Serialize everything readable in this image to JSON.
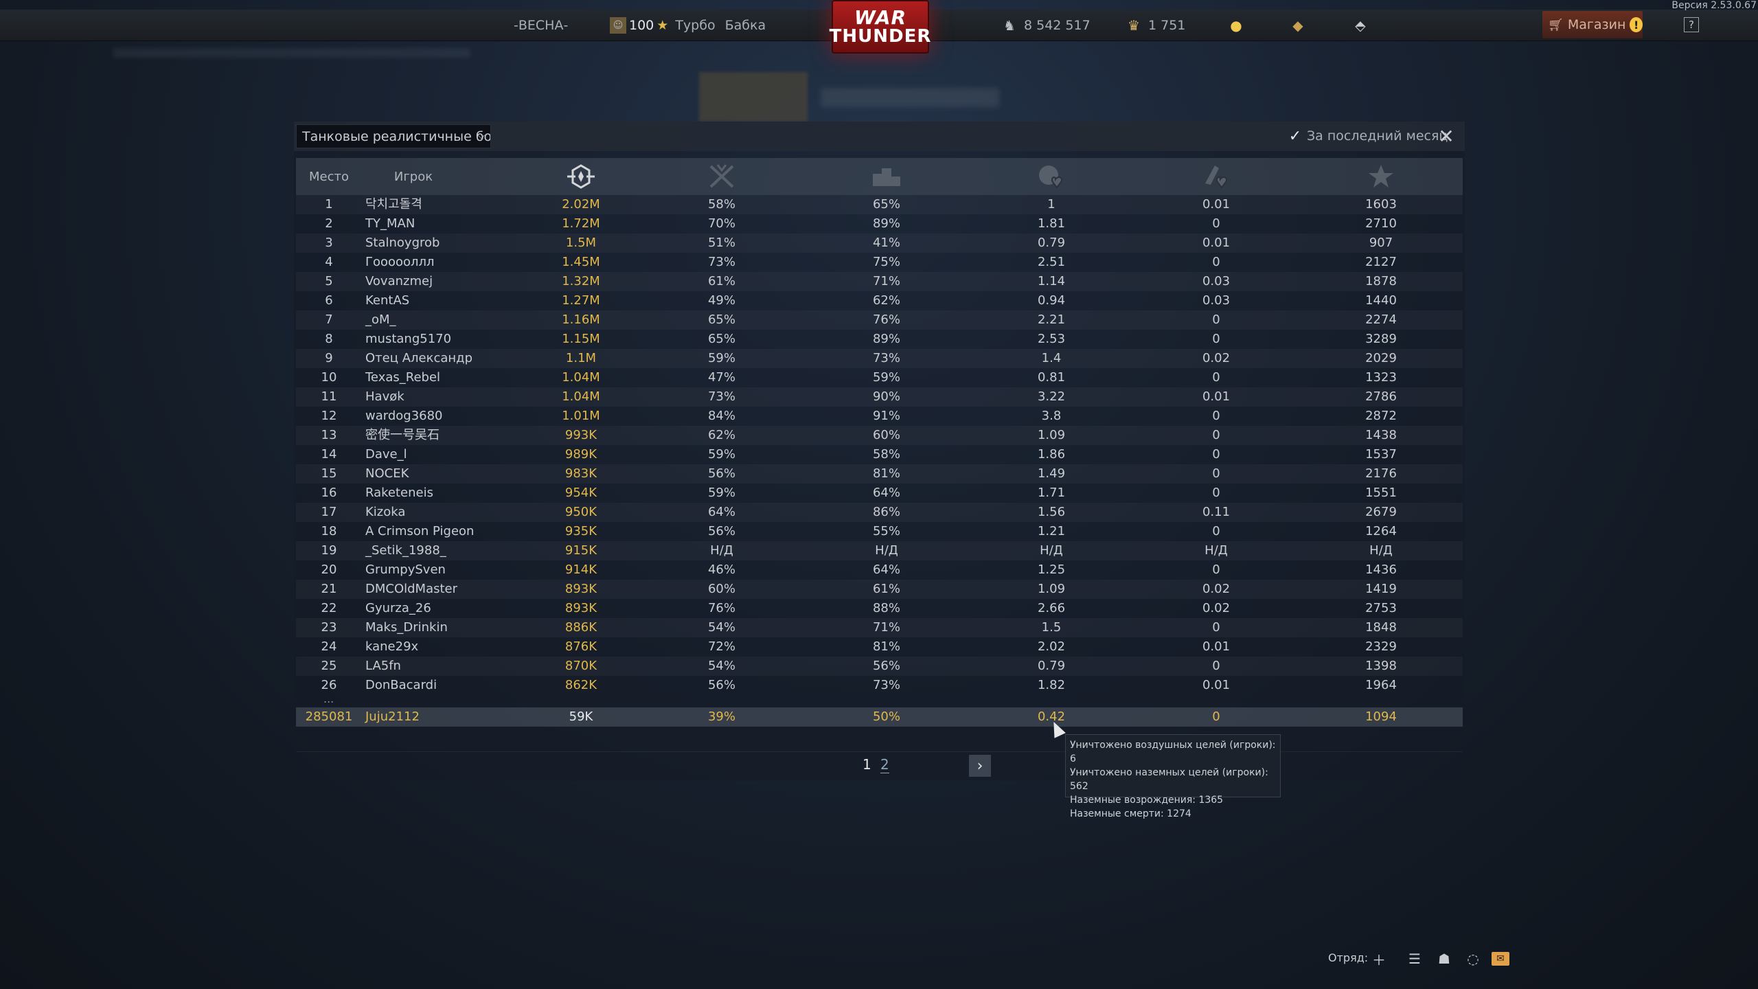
{
  "version": "Версия 2.53.0.67",
  "topbar": {
    "event": "-ВЕСНА-",
    "level": "100",
    "booster": "Турбо",
    "nick": "Бабка",
    "silver_lions": "8 542 517",
    "golden_eagles": "1 751",
    "logo_line1": "WAR",
    "logo_line2": "THUNDER",
    "shop_label": "Магазин",
    "help": "?"
  },
  "leaderboard": {
    "mode": "Танковые реалистичные бои",
    "last_month_label": "За последний месяц",
    "last_month_checked": true,
    "columns": {
      "rank": "Место",
      "player": "Игрок"
    },
    "rows": [
      {
        "rank": "1",
        "name": "닥치고돌격",
        "score": "2.02M",
        "wr": "58%",
        "top": "65%",
        "gkd": "1",
        "akd": "0.01",
        "rating": "1603"
      },
      {
        "rank": "2",
        "name": "TY_MAN",
        "score": "1.72M",
        "wr": "70%",
        "top": "89%",
        "gkd": "1.81",
        "akd": "0",
        "rating": "2710"
      },
      {
        "rank": "3",
        "name": "Stalnoygrob",
        "score": "1.5M",
        "wr": "51%",
        "top": "41%",
        "gkd": "0.79",
        "akd": "0.01",
        "rating": "907"
      },
      {
        "rank": "4",
        "name": "Гоооооллл",
        "score": "1.45M",
        "wr": "73%",
        "top": "75%",
        "gkd": "2.51",
        "akd": "0",
        "rating": "2127"
      },
      {
        "rank": "5",
        "name": "Vovanzmej",
        "score": "1.32M",
        "wr": "61%",
        "top": "71%",
        "gkd": "1.14",
        "akd": "0.03",
        "rating": "1878"
      },
      {
        "rank": "6",
        "name": "KentAS",
        "score": "1.27M",
        "wr": "49%",
        "top": "62%",
        "gkd": "0.94",
        "akd": "0.03",
        "rating": "1440"
      },
      {
        "rank": "7",
        "name": "_oM_",
        "score": "1.16M",
        "wr": "65%",
        "top": "76%",
        "gkd": "2.21",
        "akd": "0",
        "rating": "2274"
      },
      {
        "rank": "8",
        "name": "mustang5170",
        "score": "1.15M",
        "wr": "65%",
        "top": "89%",
        "gkd": "2.53",
        "akd": "0",
        "rating": "3289"
      },
      {
        "rank": "9",
        "name": "Отец Александр",
        "score": "1.1M",
        "wr": "59%",
        "top": "73%",
        "gkd": "1.4",
        "akd": "0.02",
        "rating": "2029"
      },
      {
        "rank": "10",
        "name": "Texas_Rebel",
        "score": "1.04M",
        "wr": "47%",
        "top": "59%",
        "gkd": "0.81",
        "akd": "0",
        "rating": "1323"
      },
      {
        "rank": "11",
        "name": "Havøk",
        "score": "1.04M",
        "wr": "73%",
        "top": "90%",
        "gkd": "3.22",
        "akd": "0.01",
        "rating": "2786"
      },
      {
        "rank": "12",
        "name": "wardog3680",
        "score": "1.01M",
        "wr": "84%",
        "top": "91%",
        "gkd": "3.8",
        "akd": "0",
        "rating": "2872"
      },
      {
        "rank": "13",
        "name": "密使一号吴石",
        "score": "993K",
        "wr": "62%",
        "top": "60%",
        "gkd": "1.09",
        "akd": "0",
        "rating": "1438"
      },
      {
        "rank": "14",
        "name": "Dave_l",
        "score": "989K",
        "wr": "59%",
        "top": "58%",
        "gkd": "1.86",
        "akd": "0",
        "rating": "1537"
      },
      {
        "rank": "15",
        "name": "NOCEK",
        "score": "983K",
        "wr": "56%",
        "top": "81%",
        "gkd": "1.49",
        "akd": "0",
        "rating": "2176"
      },
      {
        "rank": "16",
        "name": "Raketeneis",
        "score": "954K",
        "wr": "59%",
        "top": "64%",
        "gkd": "1.71",
        "akd": "0",
        "rating": "1551"
      },
      {
        "rank": "17",
        "name": "Kizoka",
        "score": "950K",
        "wr": "64%",
        "top": "86%",
        "gkd": "1.56",
        "akd": "0.11",
        "rating": "2679"
      },
      {
        "rank": "18",
        "name": "A Crimson Pigeon",
        "score": "935K",
        "wr": "56%",
        "top": "55%",
        "gkd": "1.21",
        "akd": "0",
        "rating": "1264"
      },
      {
        "rank": "19",
        "name": "_Setik_1988_",
        "score": "915K",
        "wr": "Н/Д",
        "top": "Н/Д",
        "gkd": "Н/Д",
        "akd": "Н/Д",
        "rating": "Н/Д"
      },
      {
        "rank": "20",
        "name": "GrumpySven",
        "score": "914K",
        "wr": "46%",
        "top": "64%",
        "gkd": "1.25",
        "akd": "0",
        "rating": "1436"
      },
      {
        "rank": "21",
        "name": "DMCOldMaster",
        "score": "893K",
        "wr": "60%",
        "top": "61%",
        "gkd": "1.09",
        "akd": "0.02",
        "rating": "1419"
      },
      {
        "rank": "22",
        "name": "Gyurza_26",
        "score": "893K",
        "wr": "76%",
        "top": "88%",
        "gkd": "2.66",
        "akd": "0.02",
        "rating": "2753"
      },
      {
        "rank": "23",
        "name": "Maks_Drinkin",
        "score": "886K",
        "wr": "54%",
        "top": "71%",
        "gkd": "1.5",
        "akd": "0",
        "rating": "1848"
      },
      {
        "rank": "24",
        "name": "kane29x",
        "score": "876K",
        "wr": "72%",
        "top": "81%",
        "gkd": "2.02",
        "akd": "0.01",
        "rating": "2329"
      },
      {
        "rank": "25",
        "name": "LA5fn",
        "score": "870K",
        "wr": "54%",
        "top": "56%",
        "gkd": "0.79",
        "akd": "0",
        "rating": "1398"
      },
      {
        "rank": "26",
        "name": "DonBacardi",
        "score": "862K",
        "wr": "56%",
        "top": "73%",
        "gkd": "1.82",
        "akd": "0.01",
        "rating": "1964"
      }
    ],
    "ellipsis": "...",
    "self": {
      "rank": "285081",
      "name": "Juju2112",
      "score": "59K",
      "wr": "39%",
      "top": "50%",
      "gkd": "0.42",
      "akd": "0",
      "rating": "1094"
    },
    "pager": {
      "page1": "1",
      "page2": "2"
    }
  },
  "tooltip": {
    "line1": "Уничтожено воздушных целей (игроки): 6",
    "line2": "Уничтожено наземных целей (игроки): 562",
    "line3": "Наземные возрождения: 1365",
    "line4": "Наземные смерти: 1274"
  },
  "bottombar": {
    "squad_label": "Отряд:"
  },
  "colors": {
    "accent_gold": "#e2b84a",
    "logo_red": "#b01e1e",
    "shop_bg": "#6a3020"
  }
}
